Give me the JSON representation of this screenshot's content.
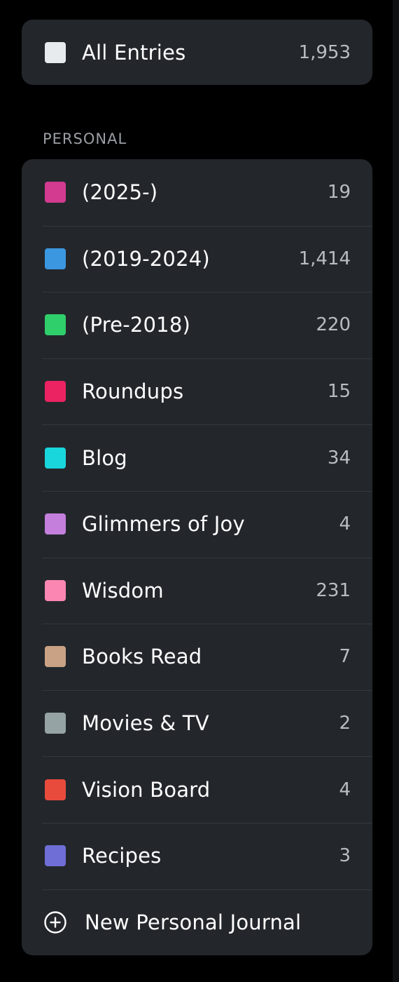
{
  "all_entries": {
    "label": "All Entries",
    "count": "1,953",
    "color": "#e8ebee"
  },
  "section": {
    "title": "PERSONAL"
  },
  "journals": [
    {
      "name": "(2025-)",
      "count": "19",
      "color": "#d23b8f"
    },
    {
      "name": "(2019-2024)",
      "count": "1,414",
      "color": "#3b97e0"
    },
    {
      "name": "(Pre-2018)",
      "count": "220",
      "color": "#2fcf6b"
    },
    {
      "name": "Roundups",
      "count": "15",
      "color": "#ec2362"
    },
    {
      "name": "Blog",
      "count": "34",
      "color": "#19d6dd"
    },
    {
      "name": "Glimmers of Joy",
      "count": "4",
      "color": "#c47fdc"
    },
    {
      "name": "Wisdom",
      "count": "231",
      "color": "#fb86b2"
    },
    {
      "name": "Books Read",
      "count": "7",
      "color": "#c9a285"
    },
    {
      "name": "Movies & TV",
      "count": "2",
      "color": "#96a3a5"
    },
    {
      "name": "Vision Board",
      "count": "4",
      "color": "#e84b3c"
    },
    {
      "name": "Recipes",
      "count": "3",
      "color": "#6f6ed6"
    }
  ],
  "new_journal": {
    "label": "New Personal Journal",
    "icon": "plus-circle-icon"
  }
}
